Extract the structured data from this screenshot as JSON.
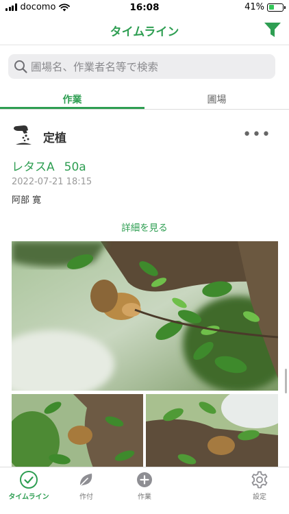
{
  "status_bar": {
    "carrier": "docomo",
    "time": "16:08",
    "battery": "41%",
    "battery_level": 0.41
  },
  "nav": {
    "title": "タイムライン",
    "filter_icon": "filter-icon"
  },
  "search": {
    "placeholder": "圃場名、作業者名等で検索"
  },
  "tabs": [
    {
      "label": "作業",
      "active": true
    },
    {
      "label": "圃場",
      "active": false
    }
  ],
  "card": {
    "icon": "planting-icon",
    "title": "定植",
    "more": "•••",
    "crop": "レタスA",
    "area": "50a",
    "date": "2022-07-21 18:15",
    "worker": "阿部 寛",
    "details_label": "詳細を見る"
  },
  "bottom_tabs": [
    {
      "label": "タイムライン",
      "icon": "check-circle-icon",
      "active": true
    },
    {
      "label": "作付",
      "icon": "leaf-icon",
      "active": false
    },
    {
      "label": "作業",
      "icon": "plus-circle-icon",
      "active": false
    },
    {
      "label": "設定",
      "icon": "gear-icon",
      "active": false
    }
  ],
  "colors": {
    "accent": "#2e9e52",
    "inactive": "#777777"
  }
}
